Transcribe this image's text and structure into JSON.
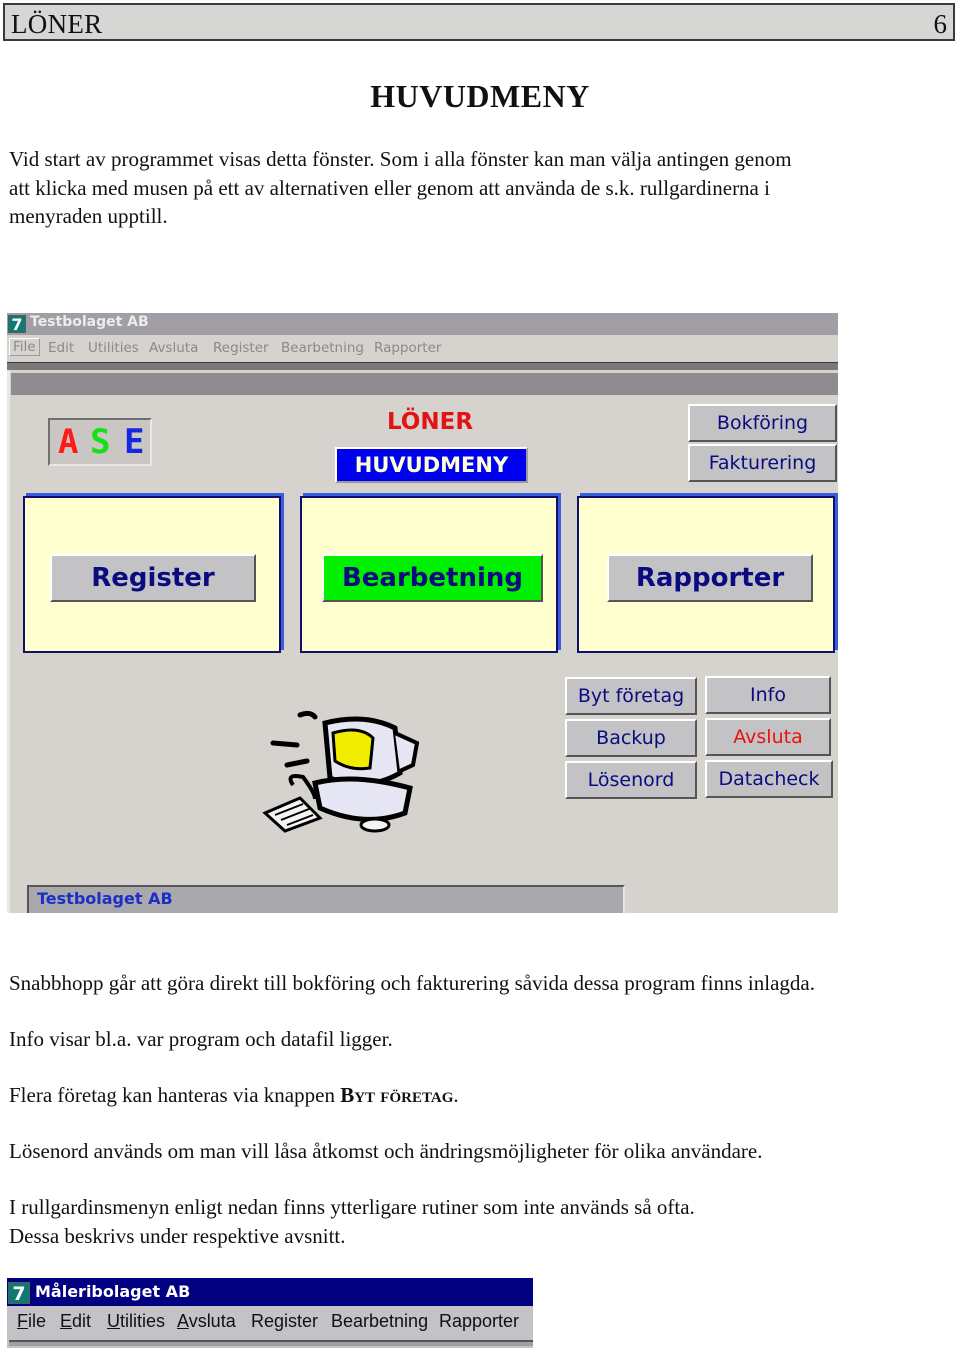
{
  "header": {
    "title": "LÖNER",
    "page_number": "6"
  },
  "section_title": "HUVUDMENY",
  "paragraphs": {
    "intro_line1": "Vid start av programmet visas detta fönster. Som i alla fönster kan man välja antingen genom",
    "intro_line2": "att klicka med musen på ett av alternativen eller genom att använda de s.k. rullgardinerna i",
    "intro_line3": "menyraden upptill.",
    "snabbhopp": "Snabbhopp går att göra direkt till bokföring och fakturering såvida dessa program finns inlagda.",
    "info": "Info visar bl.a. var program och datafil ligger.",
    "flera_prefix": "Flera företag kan hanteras via knappen ",
    "flera_strong": "Byt företag",
    "flera_suffix": ".",
    "losenord": "Lösenord används om man vill låsa åtkomst och ändringsmöjligheter för olika användare.",
    "rullgardin_line1": "I rullgardinsmenyn enligt nedan finns ytterligare rutiner som inte används så ofta.",
    "rullgardin_line2": "Dessa beskrivs under respektive avsnitt."
  },
  "screenshot_main": {
    "app_icon_glyph": "7",
    "window_title": "Testbolaget AB",
    "menu": [
      "File",
      "Edit",
      "Utilities",
      "Avsluta",
      "Register",
      "Bearbetning",
      "Rapporter"
    ],
    "logo": {
      "letters": [
        "A",
        "S",
        "E"
      ],
      "colors": [
        "#ff1a1a",
        "#18e018",
        "#1428e0"
      ]
    },
    "heading": "LÖNER",
    "menu_badge": "HUVUDMENY",
    "quick_buttons": {
      "bokforing": "Bokföring",
      "fakturering": "Fakturering"
    },
    "main_buttons": {
      "register": "Register",
      "bearbetning": "Bearbetning",
      "rapporter": "Rapporter"
    },
    "small_buttons": {
      "byt_foretag": "Byt företag",
      "info": "Info",
      "backup": "Backup",
      "avsluta": "Avsluta",
      "losenord": "Lösenord",
      "datacheck": "Datacheck"
    },
    "status_company": "Testbolaget AB",
    "colors": {
      "panel_bg": "#ffffd0",
      "active_button": "#00f000",
      "badge_bg": "#0000f0",
      "exit_text": "#ee1010",
      "button_text": "#0b0b80"
    }
  },
  "screenshot_menu": {
    "app_icon_glyph": "7",
    "window_title": "Måleribolaget AB",
    "menu": [
      {
        "label": "File",
        "accel": "F",
        "rest": "ile"
      },
      {
        "label": "Edit",
        "accel": "E",
        "rest": "dit"
      },
      {
        "label": "Utilities",
        "accel": "U",
        "rest": "tilities"
      },
      {
        "label": "Avsluta",
        "accel": "A",
        "rest": "vsluta"
      },
      {
        "label": "Register",
        "accel": "",
        "rest": "Register"
      },
      {
        "label": "Bearbetning",
        "accel": "",
        "rest": "Bearbetning"
      },
      {
        "label": "Rapporter",
        "accel": "",
        "rest": "Rapporter"
      }
    ]
  }
}
